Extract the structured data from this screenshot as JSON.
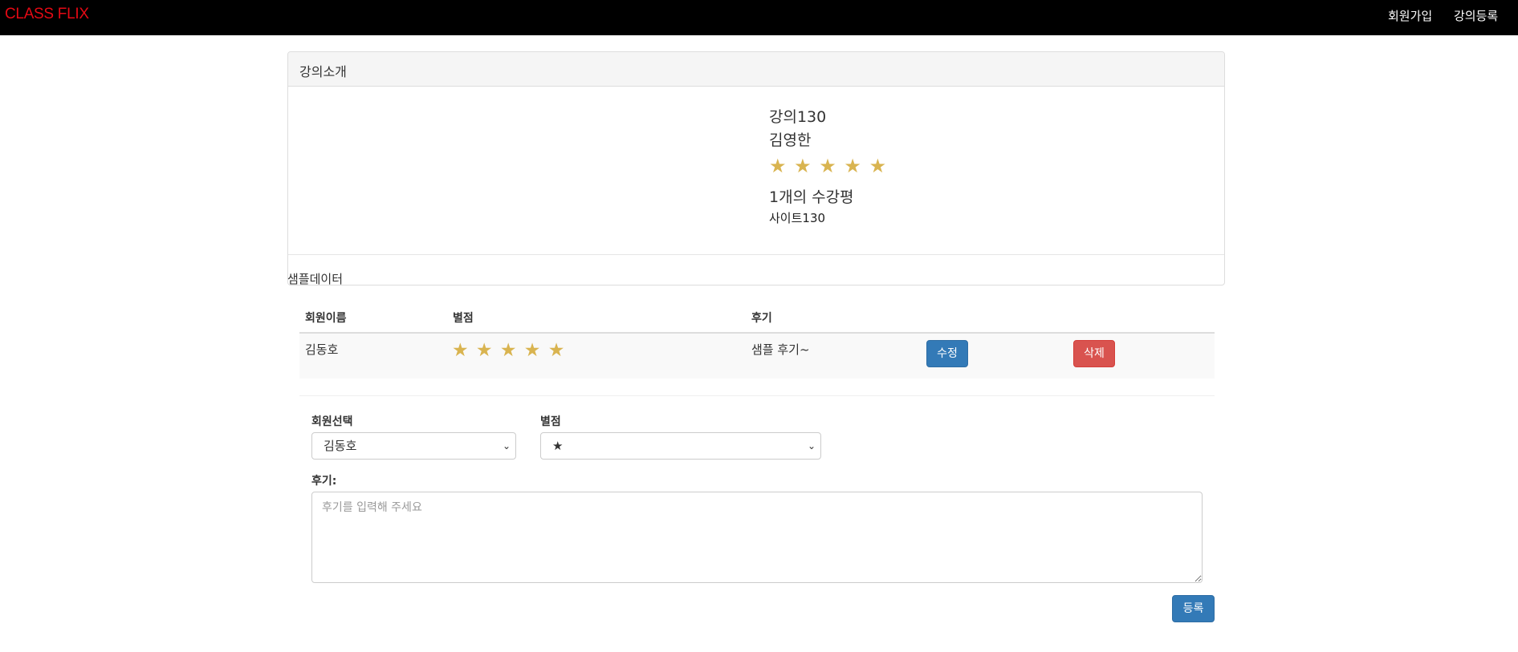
{
  "navbar": {
    "brand": "CLASS FLIX",
    "links": [
      "회원가입",
      "강의등록"
    ],
    "brand_color": "#e50914",
    "background": "#000000"
  },
  "course": {
    "panel_title": "강의소개",
    "title": "강의130",
    "instructor": "김영한",
    "rating_stars": 5,
    "stars_text": "★ ★ ★ ★ ★",
    "review_count_text": "1개의 수강평",
    "site": "사이트130",
    "footer_text": "샘플데이터"
  },
  "reviews": {
    "headers": [
      "회원이름",
      "별점",
      "후기"
    ],
    "rows": [
      {
        "member": "김동호",
        "stars": 5,
        "stars_text": "★ ★ ★ ★ ★",
        "comment": "샘플 후기~",
        "edit_label": "수정",
        "delete_label": "삭제"
      }
    ]
  },
  "form": {
    "member_label": "회원선택",
    "member_value": "김동호",
    "rating_label": "별점",
    "rating_value": "★",
    "review_label": "후기:",
    "review_placeholder": "후기를 입력해 주세요",
    "submit_label": "등록"
  },
  "colors": {
    "star": "#d9b450",
    "primary": "#337ab7",
    "danger": "#d9534f"
  }
}
